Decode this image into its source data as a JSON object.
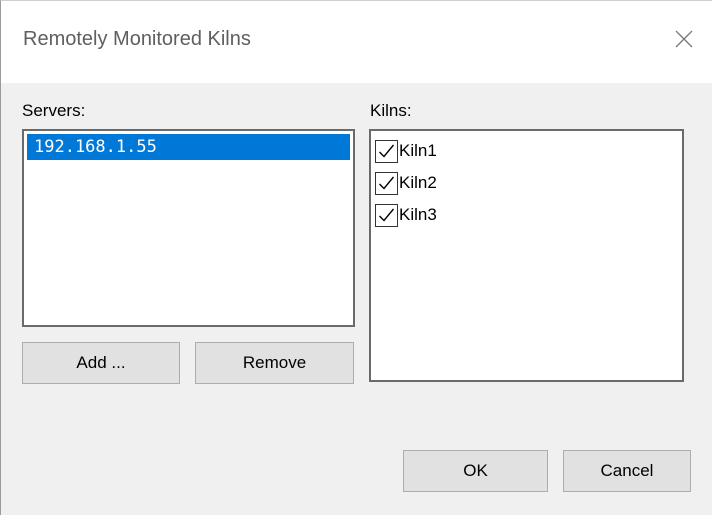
{
  "dialog": {
    "title": "Remotely Monitored Kilns",
    "close_icon": "close-icon"
  },
  "servers": {
    "label": "Servers:",
    "items": [
      "192.168.1.55"
    ],
    "selected": "192.168.1.55",
    "add_label": "Add ...",
    "remove_label": "Remove"
  },
  "kilns": {
    "label": "Kilns:",
    "items": [
      {
        "label": "Kiln1",
        "checked": true
      },
      {
        "label": "Kiln2",
        "checked": true
      },
      {
        "label": "Kiln3",
        "checked": true
      }
    ]
  },
  "footer": {
    "ok_label": "OK",
    "cancel_label": "Cancel"
  },
  "colors": {
    "selection": "#0078d7",
    "dialog_background": "#f0f0f0",
    "button_face": "#e1e1e1"
  }
}
